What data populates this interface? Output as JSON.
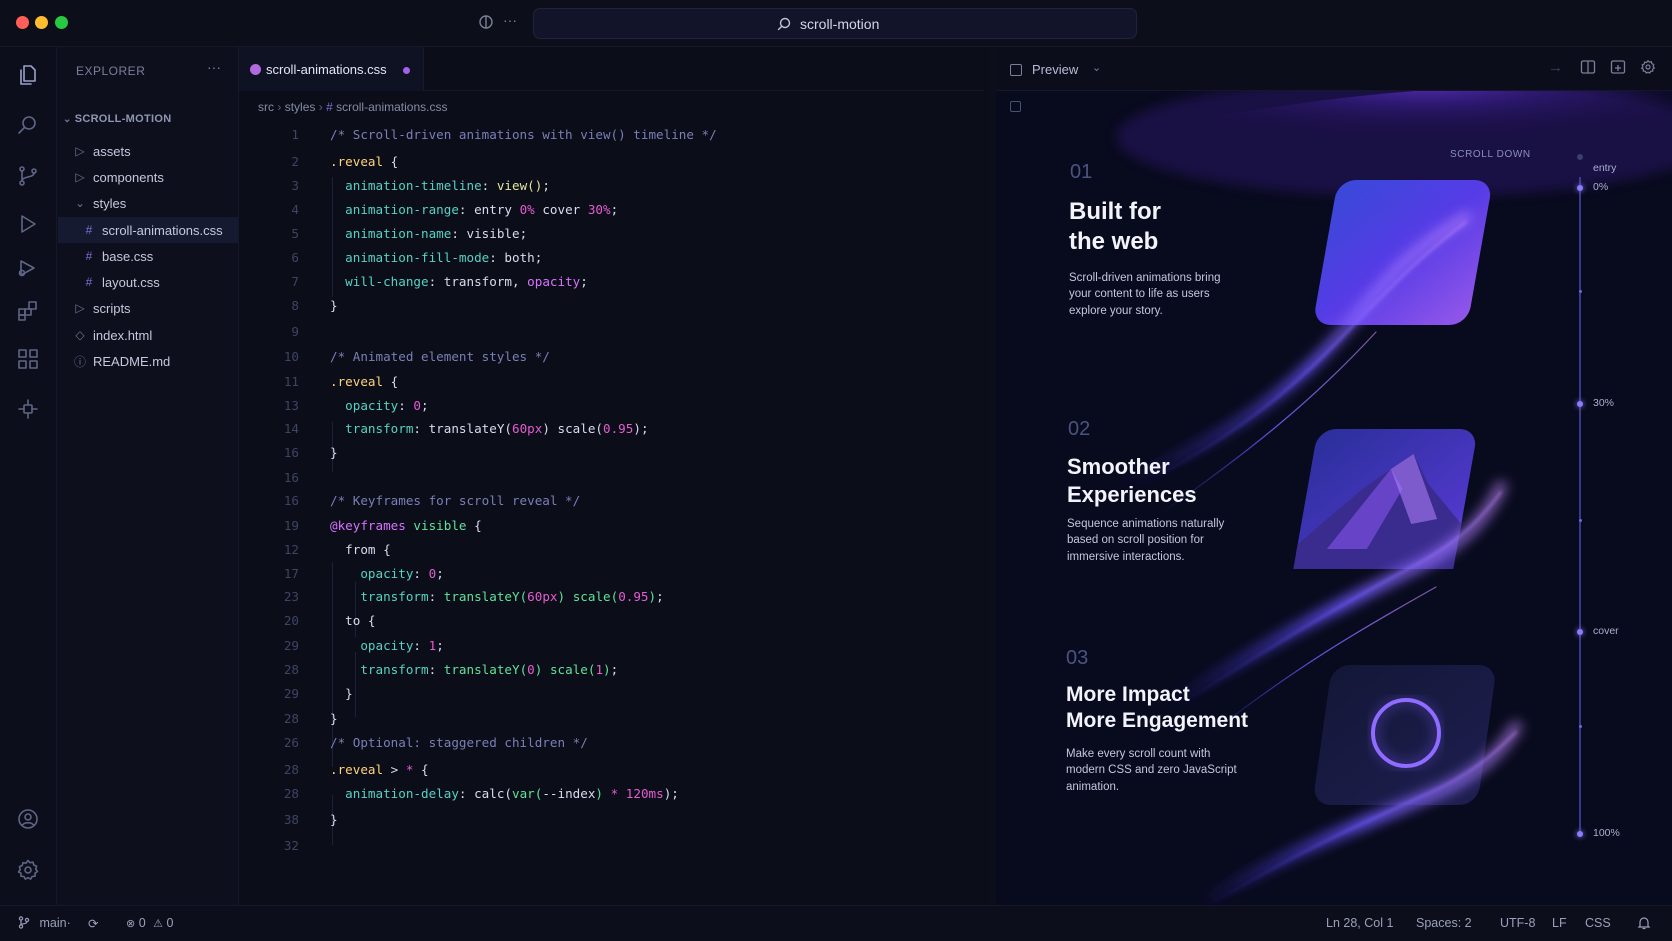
{
  "window": {
    "search_text": "scroll-motion"
  },
  "sidebar": {
    "title": "EXPLORER",
    "more": "···",
    "root": "SCROLL-MOTION",
    "items": [
      {
        "label": "assets",
        "kind": "folder-closed"
      },
      {
        "label": "components",
        "kind": "folder-closed"
      },
      {
        "label": "styles",
        "kind": "folder-open"
      },
      {
        "label": "scroll-animations.css",
        "kind": "css"
      },
      {
        "label": "base.css",
        "kind": "css"
      },
      {
        "label": "layout.css",
        "kind": "css"
      },
      {
        "label": "scripts",
        "kind": "folder-closed"
      },
      {
        "label": "index.html",
        "kind": "html"
      },
      {
        "label": "README.md",
        "kind": "md"
      }
    ]
  },
  "editor": {
    "tab_label": "scroll-animations.css",
    "breadcrumb": {
      "a": "src",
      "b": "styles",
      "c": "scroll-animations.css"
    },
    "line_numbers": [
      "1",
      "2",
      "3",
      "4",
      "5",
      "6",
      "7",
      "8",
      "9",
      "10",
      "11",
      "13",
      "14",
      "16",
      "16",
      "16",
      "19",
      "12",
      "17",
      "23",
      "20",
      "29",
      "28",
      "29",
      "28",
      "26",
      "28",
      "28",
      "38",
      "32"
    ]
  },
  "preview": {
    "tab_label": "Preview",
    "scroll_hint": "SCROLL DOWN",
    "sections": [
      {
        "num": "01",
        "title_1": "Built for",
        "title_2": "the web",
        "body_1": "Scroll-driven animations bring",
        "body_2": "your content to life as users",
        "body_3": "explore your story."
      },
      {
        "num": "02",
        "title_1": "Smoother",
        "title_2": "Experiences",
        "body_1": "Sequence animations naturally",
        "body_2": "based on scroll position for",
        "body_3": "immersive interactions."
      },
      {
        "num": "03",
        "title_1": "More Impact",
        "title_2": "More Engagement",
        "body_1": "Make every scroll count with",
        "body_2": "modern CSS and zero JavaScript",
        "body_3": "animation."
      }
    ],
    "rail": {
      "entry": "entry",
      "p0": "0%",
      "p30": "30%",
      "cover": "cover",
      "p100": "100%"
    }
  },
  "status": {
    "branch": "main",
    "branch_sep": "·",
    "errors": "0",
    "warnings": "0",
    "cursor": "Ln 28, Col 1",
    "spaces": "Spaces: 2",
    "encoding": "UTF-8",
    "eol": "LF",
    "language": "CSS"
  },
  "colors": {
    "accent": "#8a7bff",
    "background": "#0b0d19",
    "modified_dot": "#a560e8"
  }
}
